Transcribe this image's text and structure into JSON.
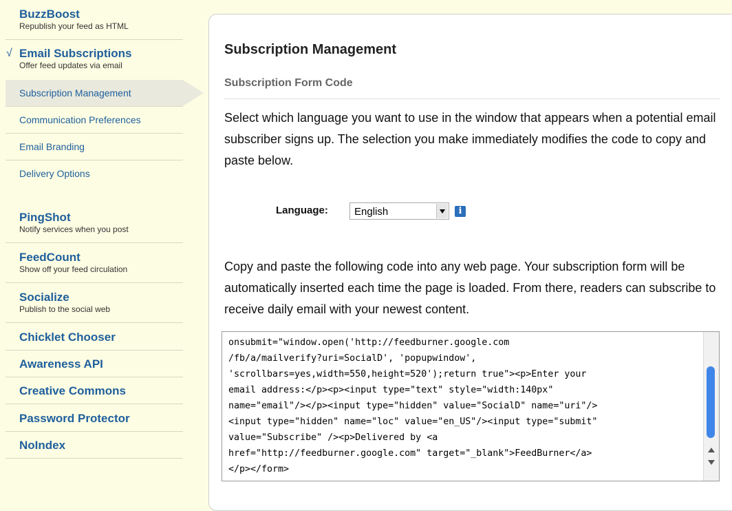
{
  "sidebar": {
    "buzzboost": {
      "title": "BuzzBoost",
      "desc": "Republish your feed as HTML"
    },
    "email": {
      "check": "√",
      "title": "Email Subscriptions",
      "desc": "Offer feed updates via email",
      "subitems": [
        "Subscription Management",
        "Communication Preferences",
        "Email Branding",
        "Delivery Options"
      ]
    },
    "pingshot": {
      "title": "PingShot",
      "desc": "Notify services when you post"
    },
    "feedcount": {
      "title": "FeedCount",
      "desc": "Show off your feed circulation"
    },
    "socialize": {
      "title": "Socialize",
      "desc": "Publish to the social web"
    },
    "plain": [
      "Chicklet Chooser",
      "Awareness API",
      "Creative Commons",
      "Password Protector",
      "NoIndex"
    ]
  },
  "main": {
    "title": "Subscription Management",
    "section": "Subscription Form Code",
    "intro": "Select which language you want to use in the window that appears when a potential email subscriber signs up. The selection you make immediately modifies the code to copy and paste below.",
    "language_label": "Language:",
    "language_value": "English",
    "info_icon": "i",
    "copy_text": "Copy and paste the following code into any web page. Your subscription form will be automatically inserted each time the page is loaded. From there, readers can subscribe to receive daily email with your newest content.",
    "code": "onsubmit=\"window.open('http://feedburner.google.com\n/fb/a/mailverify?uri=SocialD', 'popupwindow',\n'scrollbars=yes,width=550,height=520');return true\"><p>Enter your\nemail address:</p><p><input type=\"text\" style=\"width:140px\"\nname=\"email\"/></p><input type=\"hidden\" value=\"SocialD\" name=\"uri\"/>\n<input type=\"hidden\" name=\"loc\" value=\"en_US\"/><input type=\"submit\"\nvalue=\"Subscribe\" /><p>Delivered by <a\nhref=\"http://feedburner.google.com\" target=\"_blank\">FeedBurner</a>\n</p></form>"
  },
  "colors": {
    "link": "#1f5f9c",
    "background": "#fdfde3",
    "active": "#e9e9dd",
    "scroll_thumb": "#3f86e8"
  }
}
